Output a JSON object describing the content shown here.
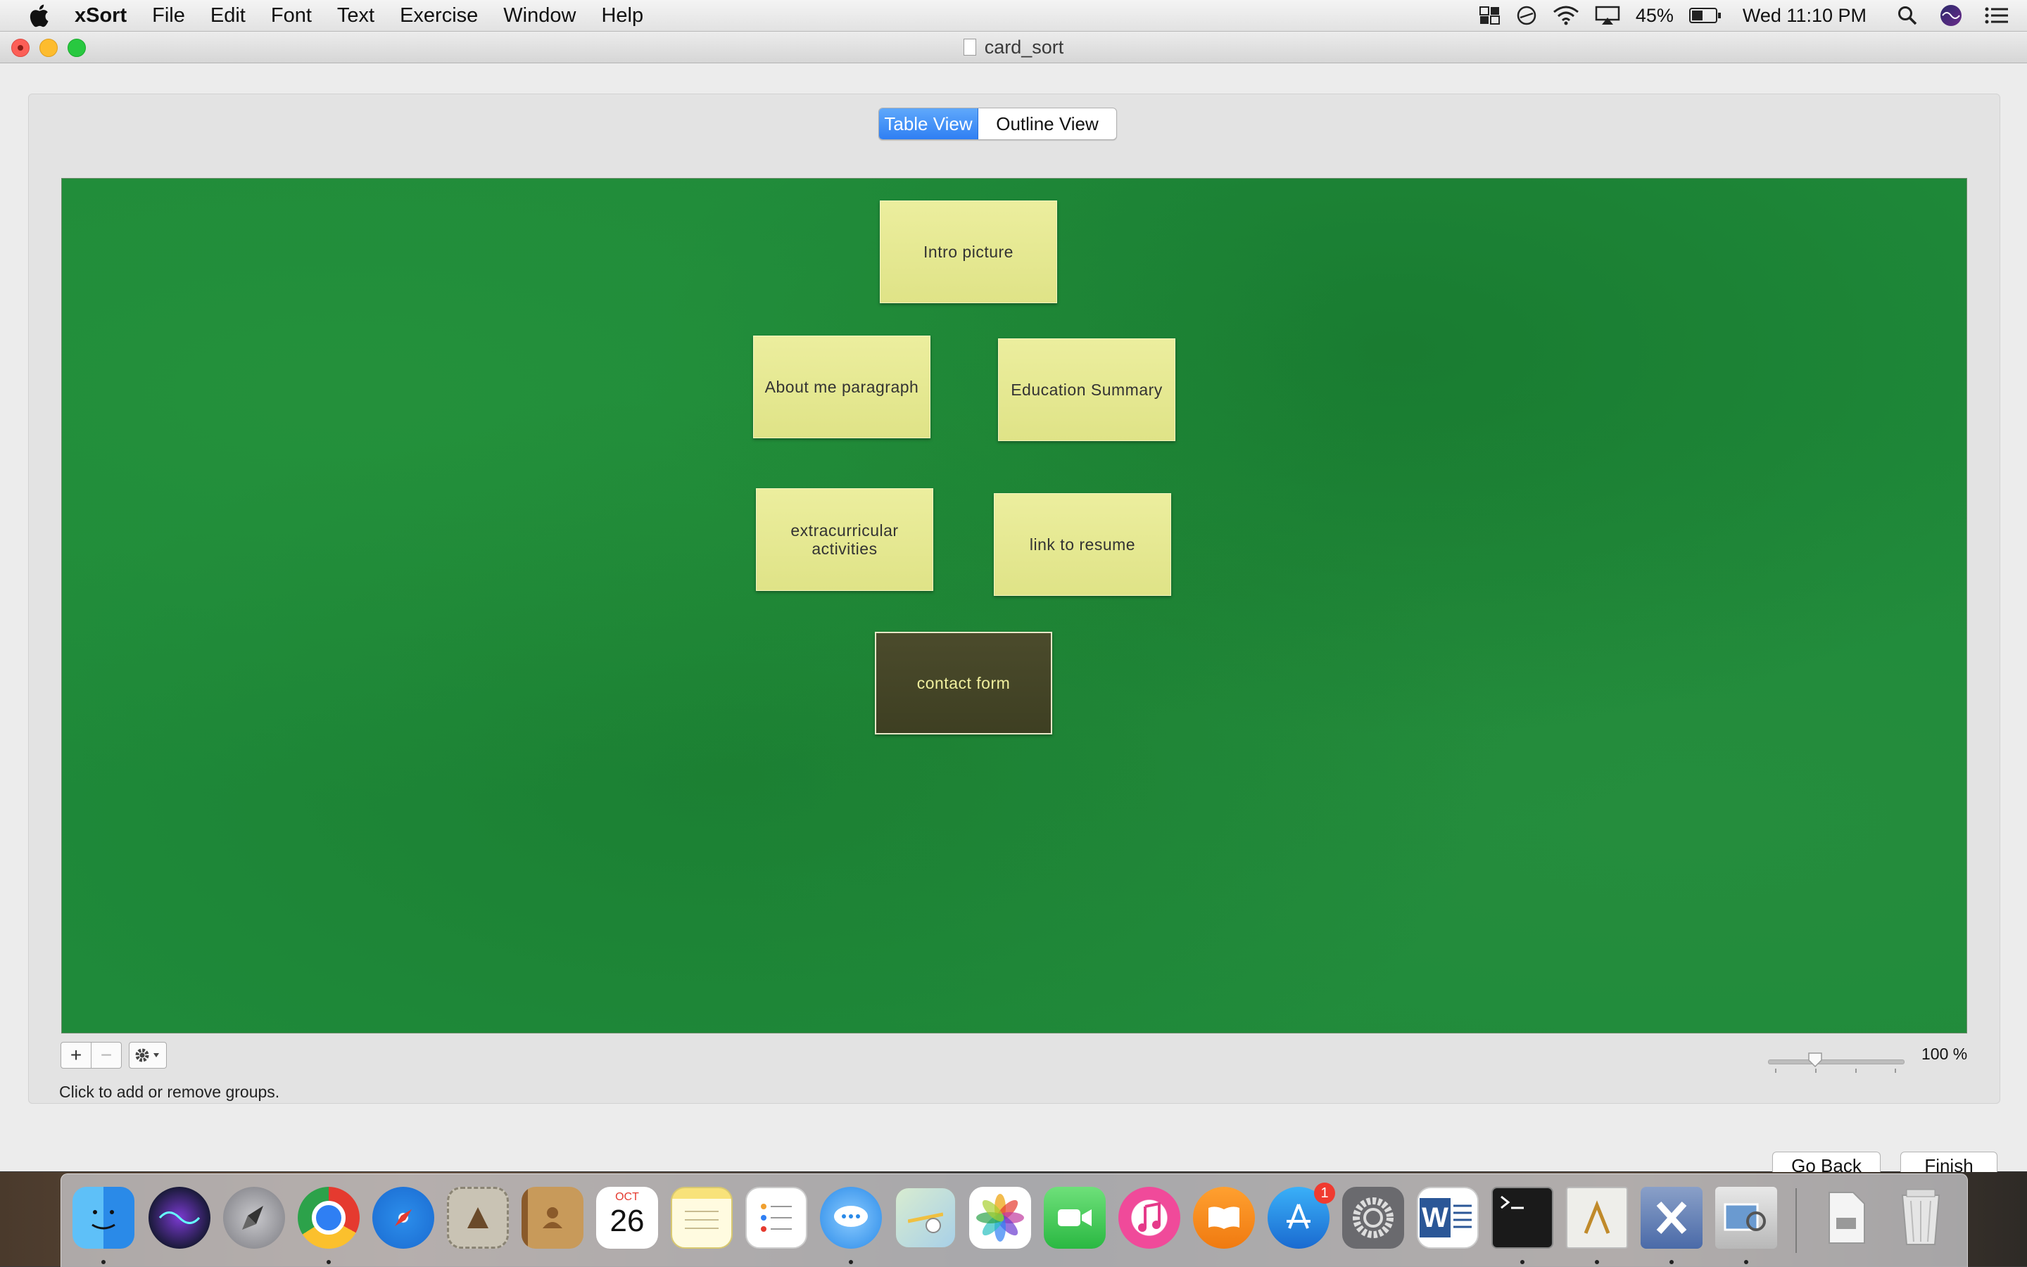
{
  "menubar": {
    "app_name": "xSort",
    "items": [
      "File",
      "Edit",
      "Font",
      "Text",
      "Exercise",
      "Window",
      "Help"
    ],
    "battery": "45%",
    "clock": "Wed 11:10 PM"
  },
  "window": {
    "title": "card_sort"
  },
  "view_tabs": {
    "table_view": "Table View",
    "outline_view": "Outline View",
    "selected": "Table View"
  },
  "cards": [
    {
      "label": "Intro picture",
      "selected": false
    },
    {
      "label": "About me paragraph",
      "selected": false
    },
    {
      "label": "Education Summary",
      "selected": false
    },
    {
      "label": "extracurricular activities",
      "selected": false
    },
    {
      "label": "link to resume",
      "selected": false
    },
    {
      "label": "contact form",
      "selected": true
    }
  ],
  "group_controls": {
    "add": "+",
    "remove": "−",
    "hint": "Click to add or remove groups."
  },
  "zoom": {
    "label": "100 %",
    "value_percent": 100
  },
  "buttons": {
    "go_back": "Go Back",
    "finish": "Finish"
  },
  "dock": {
    "calendar_month": "OCT",
    "calendar_day": "26",
    "app_store_badge": "1",
    "word_letter": "W"
  },
  "colors": {
    "board_green": "#1f8a3a",
    "card_yellow": "#e6e893",
    "selected_card": "#43442a",
    "accent_blue": "#2f7ff3"
  }
}
